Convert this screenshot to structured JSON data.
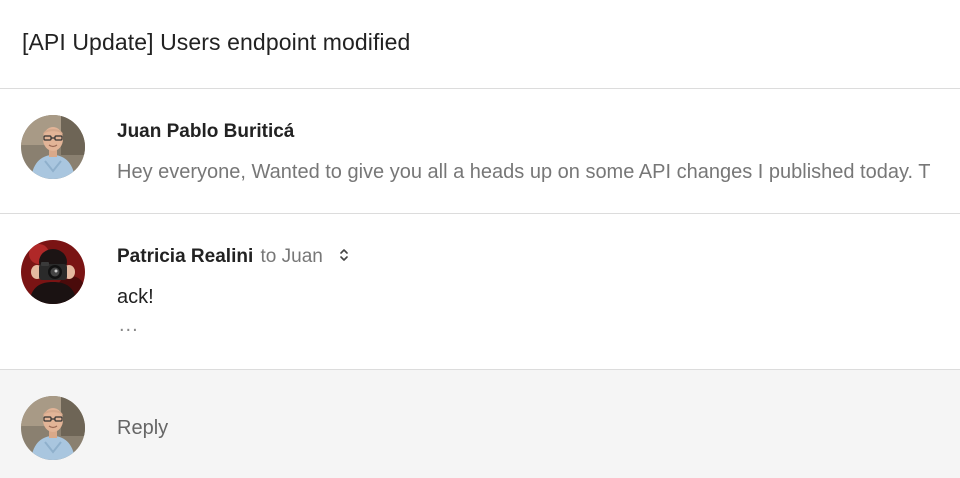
{
  "thread": {
    "subject": "[API Update] Users endpoint modified"
  },
  "messages": [
    {
      "sender": "Juan Pablo Buriticá",
      "snippet": "Hey everyone, Wanted to give you all a heads up on some API changes I published today. T",
      "avatar_icon": "person-avatar-icon"
    },
    {
      "sender": "Patricia Realini",
      "recipient_prefix": "to",
      "recipient": "Juan",
      "body": "ack!",
      "trimmed_content": "...",
      "avatar_icon": "camera-person-avatar-icon"
    }
  ],
  "reply": {
    "label": "Reply"
  },
  "colors": {
    "divider": "#dcdcdc",
    "reply_background": "#f5f5f5",
    "muted_text": "#777777",
    "primary_text": "#222222"
  }
}
